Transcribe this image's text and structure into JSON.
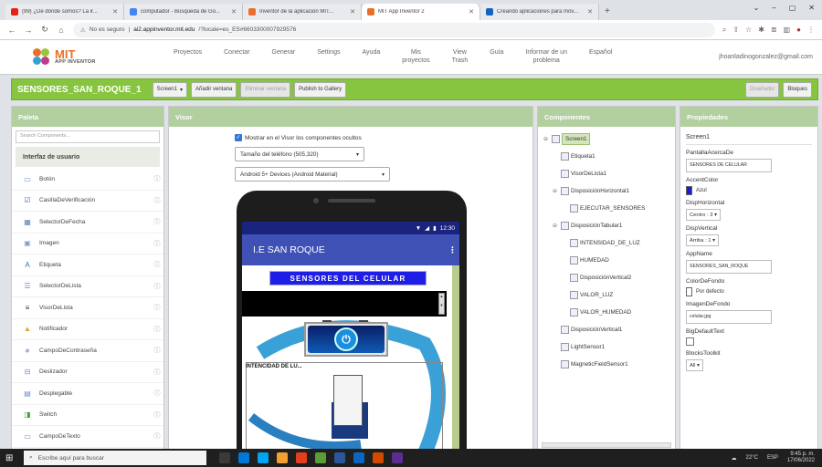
{
  "browser": {
    "tabs": [
      {
        "title": "(99) ¿De dónde somos? La ir...",
        "color": "#e62117"
      },
      {
        "title": "computador - Búsqueda de Go...",
        "color": "#4285f4"
      },
      {
        "title": "Inventor de la aplicación MIT...",
        "color": "#e8702a"
      },
      {
        "title": "MIT App Inventor 2",
        "color": "#e8702a"
      },
      {
        "title": "Creando aplicaciones para móv...",
        "color": "#1565c0"
      }
    ],
    "new_tab": "+",
    "win_controls": [
      "⌄",
      "–",
      "▢",
      "✕"
    ],
    "address": {
      "security": "No es seguro",
      "host": "ai2.appinventor.mit.edu",
      "path": "/?locale=es_ES#6603300007929576"
    }
  },
  "app_menu": {
    "brand_top": "MIT",
    "brand_bottom": "APP INVENTOR",
    "items": [
      "Proyectos",
      "Conectar",
      "Generar",
      "Settings",
      "Ayuda",
      "Mis\nproyectos",
      "View\nTrash",
      "Guía",
      "Informar de un\nproblema",
      "Español"
    ],
    "user": "jhoanladinogonzalez@gmail.com"
  },
  "project_bar": {
    "name": "SENSORES_SAN_ROQUE_1",
    "screen_select": "Screen1",
    "add_screen": "Añadir ventana",
    "remove_screen": "Eliminar ventana",
    "publish": "Publish to Gallery",
    "designer": "Diseñador",
    "blocks": "Bloques"
  },
  "palette": {
    "title": "Paleta",
    "search_placeholder": "Search Components...",
    "category": "Interfaz de usuario",
    "items": [
      {
        "label": "Botón",
        "icon": "button-icon",
        "glyph": "▭",
        "color": "#6a8fc8"
      },
      {
        "label": "CasillaDeVerificación",
        "icon": "checkbox-icon",
        "glyph": "☑",
        "color": "#3a6fb0"
      },
      {
        "label": "SelectorDeFecha",
        "icon": "calendar-icon",
        "glyph": "▦",
        "color": "#5a7fb5"
      },
      {
        "label": "Imagen",
        "icon": "image-icon",
        "glyph": "▣",
        "color": "#7da0cc"
      },
      {
        "label": "Etiqueta",
        "icon": "label-icon",
        "glyph": "A",
        "color": "#3a6fb0"
      },
      {
        "label": "SelectorDeLista",
        "icon": "listpicker-icon",
        "glyph": "☰",
        "color": "#6a8fc8"
      },
      {
        "label": "VisorDeLista",
        "icon": "listview-icon",
        "glyph": "≡",
        "color": "#333"
      },
      {
        "label": "Notificador",
        "icon": "notifier-icon",
        "glyph": "▲",
        "color": "#e0a020"
      },
      {
        "label": "CampoDeContraseña",
        "icon": "password-icon",
        "glyph": "∗",
        "color": "#6a8fc8"
      },
      {
        "label": "Deslizador",
        "icon": "slider-icon",
        "glyph": "⊟",
        "color": "#6a8fc8"
      },
      {
        "label": "Desplegable",
        "icon": "spinner-icon",
        "glyph": "▤",
        "color": "#6a8fc8"
      },
      {
        "label": "Switch",
        "icon": "switch-icon",
        "glyph": "◨",
        "color": "#40a040"
      },
      {
        "label": "CampoDeTexto",
        "icon": "textbox-icon",
        "glyph": "▭",
        "color": "#6a8fc8"
      }
    ]
  },
  "viewer": {
    "title": "Visor",
    "show_hidden": "Mostrar en el Visor los componentes ocultos",
    "size_select": "Tamaño del teléfono (505,320)",
    "theme_select": "Android 5+ Devices (Android Material)",
    "phone": {
      "time": "12:30",
      "app_title": "I.E SAN ROQUE",
      "banner": "SENSORES DEL CELULAR",
      "table_label": "INTENCIDAD DE LU..."
    }
  },
  "components": {
    "title": "Componentes",
    "tree": [
      {
        "label": "Screen1",
        "depth": 0,
        "toggle": "⊖",
        "selected": true
      },
      {
        "label": "Etiqueta1",
        "depth": 1,
        "toggle": ""
      },
      {
        "label": "VisorDeLista1",
        "depth": 1,
        "toggle": ""
      },
      {
        "label": "DisposiciónHorizontal1",
        "depth": 1,
        "toggle": "⊖"
      },
      {
        "label": "EJECUTAR_SENSORES",
        "depth": 2,
        "toggle": ""
      },
      {
        "label": "DisposiciónTabular1",
        "depth": 1,
        "toggle": "⊖"
      },
      {
        "label": "INTENSIDAD_DE_LUZ",
        "depth": 2,
        "toggle": ""
      },
      {
        "label": "HUMEDAD",
        "depth": 2,
        "toggle": ""
      },
      {
        "label": "DisposiciónVertical2",
        "depth": 2,
        "toggle": ""
      },
      {
        "label": "VALOR_LUZ",
        "depth": 2,
        "toggle": ""
      },
      {
        "label": "VALOR_HUMEDAD",
        "depth": 2,
        "toggle": ""
      },
      {
        "label": "DisposiciónVertical1",
        "depth": 1,
        "toggle": ""
      },
      {
        "label": "LightSensor1",
        "depth": 1,
        "toggle": ""
      },
      {
        "label": "MagneticFieldSensor1",
        "depth": 1,
        "toggle": ""
      }
    ]
  },
  "properties": {
    "title": "Propiedades",
    "screen": "Screen1",
    "items": [
      {
        "label": "PantallaAcercaDe",
        "type": "input",
        "value": "SENSORES DE CELULAR"
      },
      {
        "label": "AccentColor",
        "type": "color",
        "value": "Azul",
        "swatch": "#1a1ad6"
      },
      {
        "label": "DispHorizontal",
        "type": "dropdown",
        "value": "Centro : 3 ▾"
      },
      {
        "label": "DispVertical",
        "type": "dropdown",
        "value": "Arriba : 1 ▾"
      },
      {
        "label": "AppName",
        "type": "input",
        "value": "SENSORES_SAN_ROQUE"
      },
      {
        "label": "ColorDeFondo",
        "type": "color",
        "value": "Por defecto",
        "swatch": "#ffffff"
      },
      {
        "label": "ImagenDeFondo",
        "type": "input",
        "value": "celular.jpg"
      },
      {
        "label": "BigDefaultText",
        "type": "checkbox",
        "value": ""
      },
      {
        "label": "BlocksToolkit",
        "type": "dropdown",
        "value": "All ▾"
      }
    ]
  },
  "taskbar": {
    "search_placeholder": "Escribe aquí para buscar",
    "weather": "22°C",
    "lang": "ESP",
    "time": "9:45 p. m.",
    "date": "17/06/2022",
    "app_colors": [
      "#3a3a3a",
      "#0078d7",
      "#00a4ef",
      "#f0a030",
      "#e04020",
      "#5a9e3a",
      "#2b579a",
      "#0a66c2",
      "#d04a00",
      "#5c2d91"
    ]
  }
}
